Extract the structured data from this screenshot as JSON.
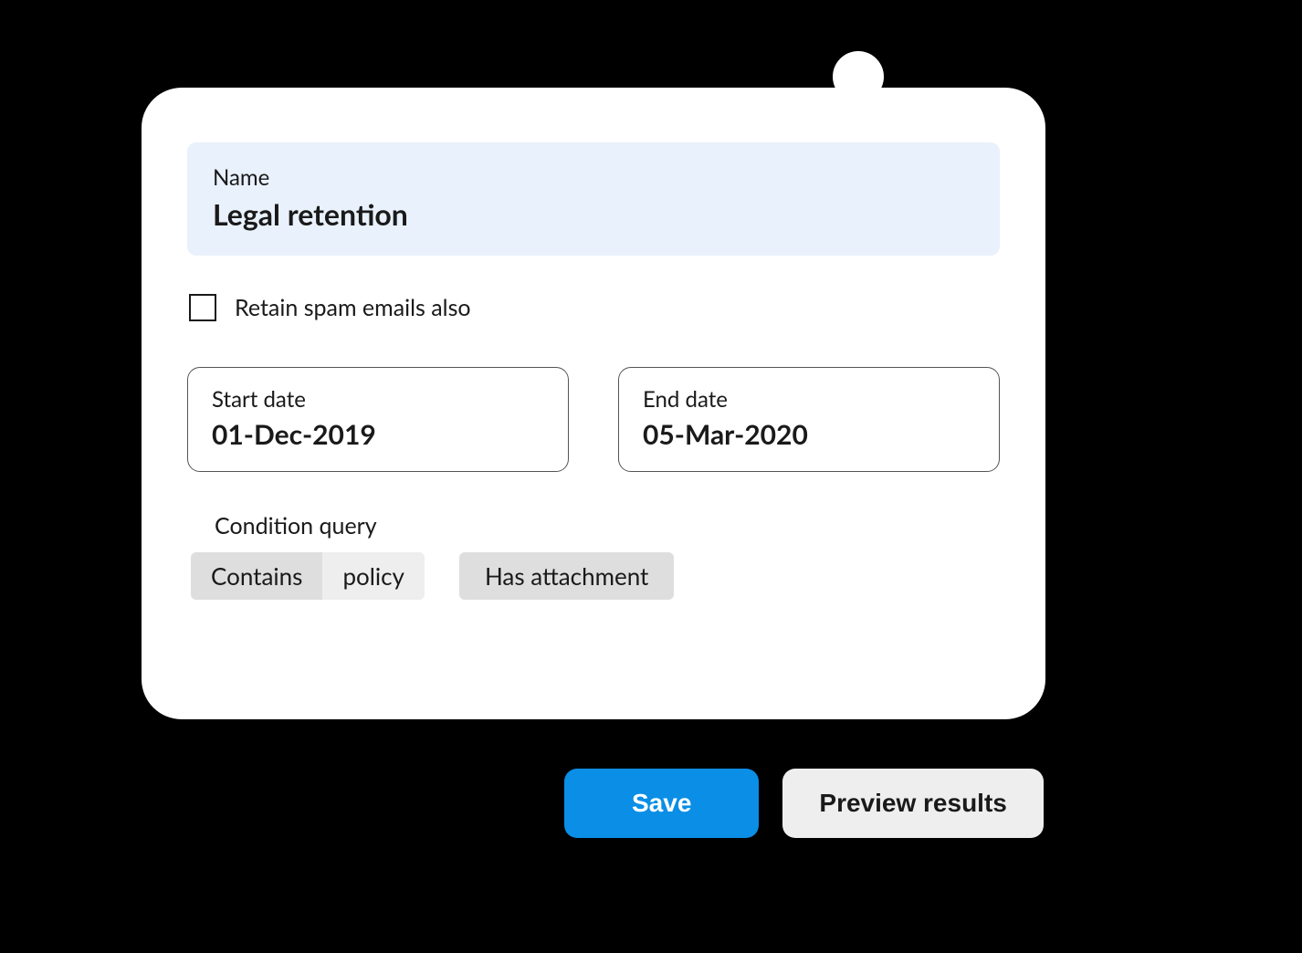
{
  "form": {
    "name_label": "Name",
    "name_value": "Legal retention",
    "retain_spam_label": "Retain spam emails also",
    "retain_spam_checked": false,
    "start_date": {
      "label": "Start date",
      "value": "01-Dec-2019"
    },
    "end_date": {
      "label": "End date",
      "value": "05-Mar-2020"
    },
    "condition": {
      "label": "Condition query",
      "chips": [
        {
          "type": "pair",
          "operator": "Contains",
          "value": "policy"
        },
        {
          "type": "single",
          "label": "Has attachment"
        }
      ]
    }
  },
  "actions": {
    "save_label": "Save",
    "preview_label": "Preview results"
  }
}
